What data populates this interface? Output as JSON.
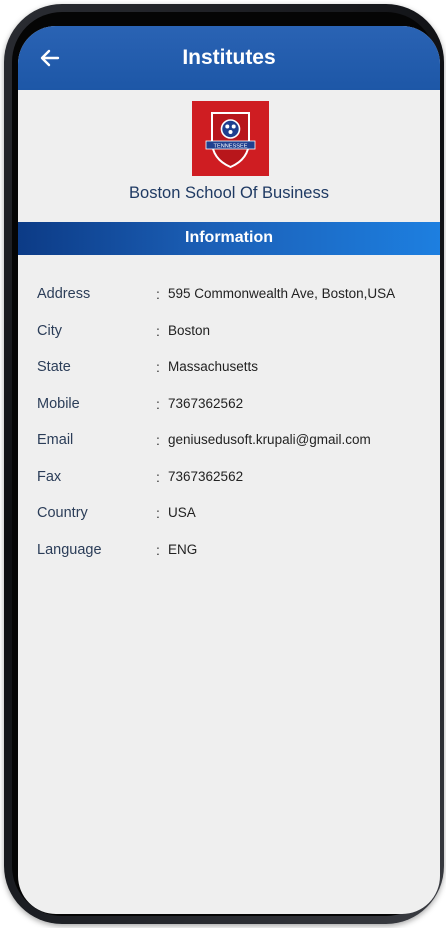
{
  "header": {
    "title": "Institutes",
    "back_icon": "arrow-left-icon"
  },
  "institute": {
    "logo_text": "TENNESSEE",
    "name": "Boston School Of Business"
  },
  "section": {
    "label": "Information"
  },
  "details": [
    {
      "key": "Address",
      "value": "595 Commonwealth Ave, Boston,USA"
    },
    {
      "key": "City",
      "value": "Boston"
    },
    {
      "key": "State",
      "value": "Massachusetts"
    },
    {
      "key": "Mobile",
      "value": "7367362562"
    },
    {
      "key": "Email",
      "value": "geniusedusoft.krupali@gmail.com"
    },
    {
      "key": "Fax",
      "value": "7367362562"
    },
    {
      "key": "Country",
      "value": "USA"
    },
    {
      "key": "Language",
      "value": "ENG"
    }
  ],
  "colors": {
    "appbar": "#1d57a7",
    "logo_bg": "#cf1d22",
    "name_text": "#1f3a63"
  }
}
